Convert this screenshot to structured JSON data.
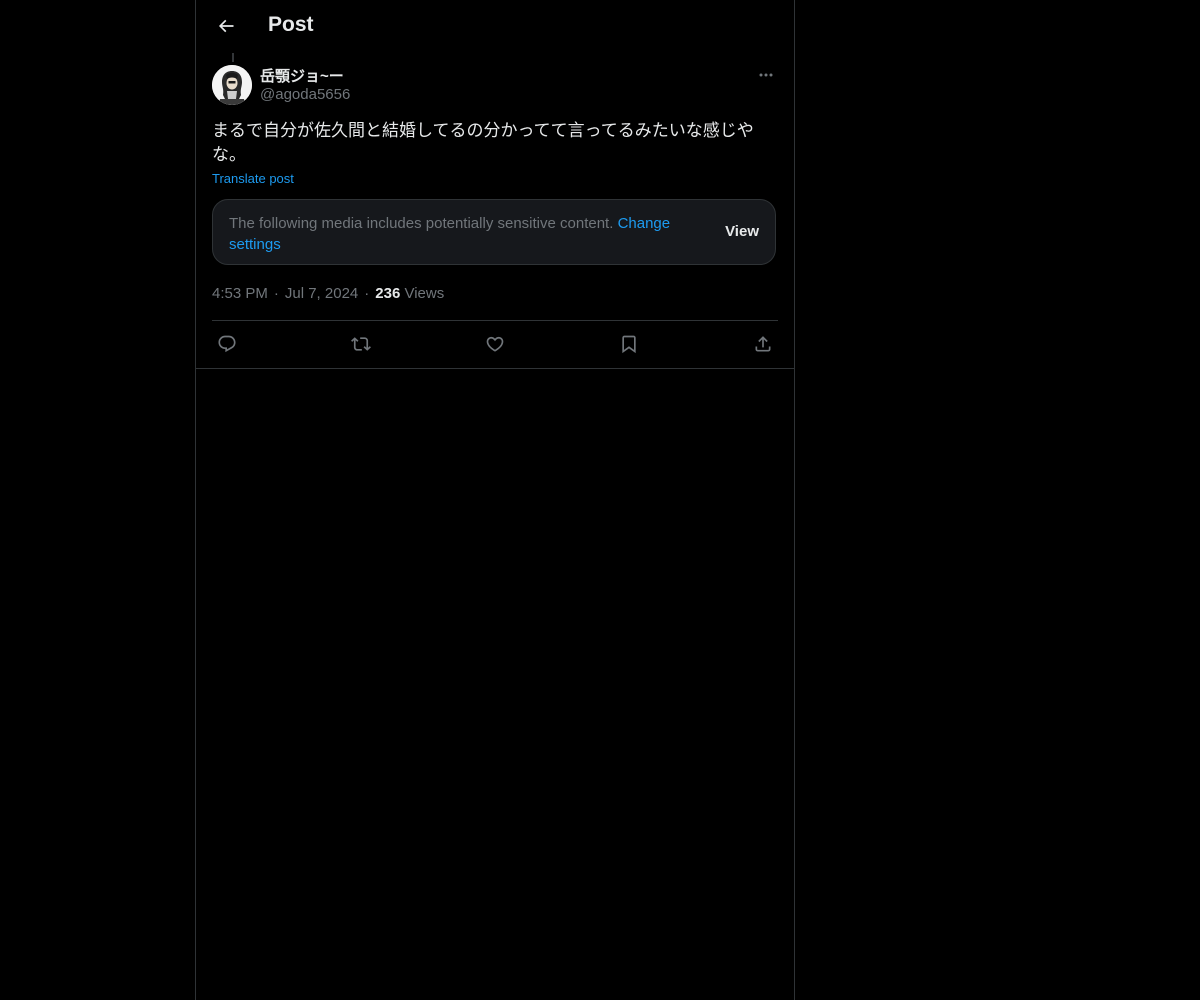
{
  "header": {
    "title": "Post",
    "back_icon": "arrow-left-icon"
  },
  "post": {
    "author": {
      "display_name": "岳顎ジョ~ー",
      "handle": "@agoda5656",
      "avatar_icon": "user-avatar"
    },
    "text": "まるで自分が佐久間と結婚してるの分かってて言ってるみたいな感じやな。",
    "translate_label": "Translate post",
    "sensitive_notice": {
      "message": "The following media includes potentially sensitive content.",
      "change_settings_label": "Change settings",
      "view_label": "View"
    },
    "meta": {
      "time": "4:53 PM",
      "date": "Jul 7, 2024",
      "views_count": "236",
      "views_label": "Views"
    },
    "actions": [
      {
        "name": "reply",
        "icon": "reply-icon"
      },
      {
        "name": "repost",
        "icon": "repost-icon"
      },
      {
        "name": "like",
        "icon": "heart-icon"
      },
      {
        "name": "bookmark",
        "icon": "bookmark-icon"
      },
      {
        "name": "share",
        "icon": "share-icon"
      }
    ]
  },
  "colors": {
    "background": "#000000",
    "text_primary": "#e7e9ea",
    "text_secondary": "#71767b",
    "accent": "#1d9bf0",
    "border": "#2f3336",
    "card_background": "#16181c"
  }
}
